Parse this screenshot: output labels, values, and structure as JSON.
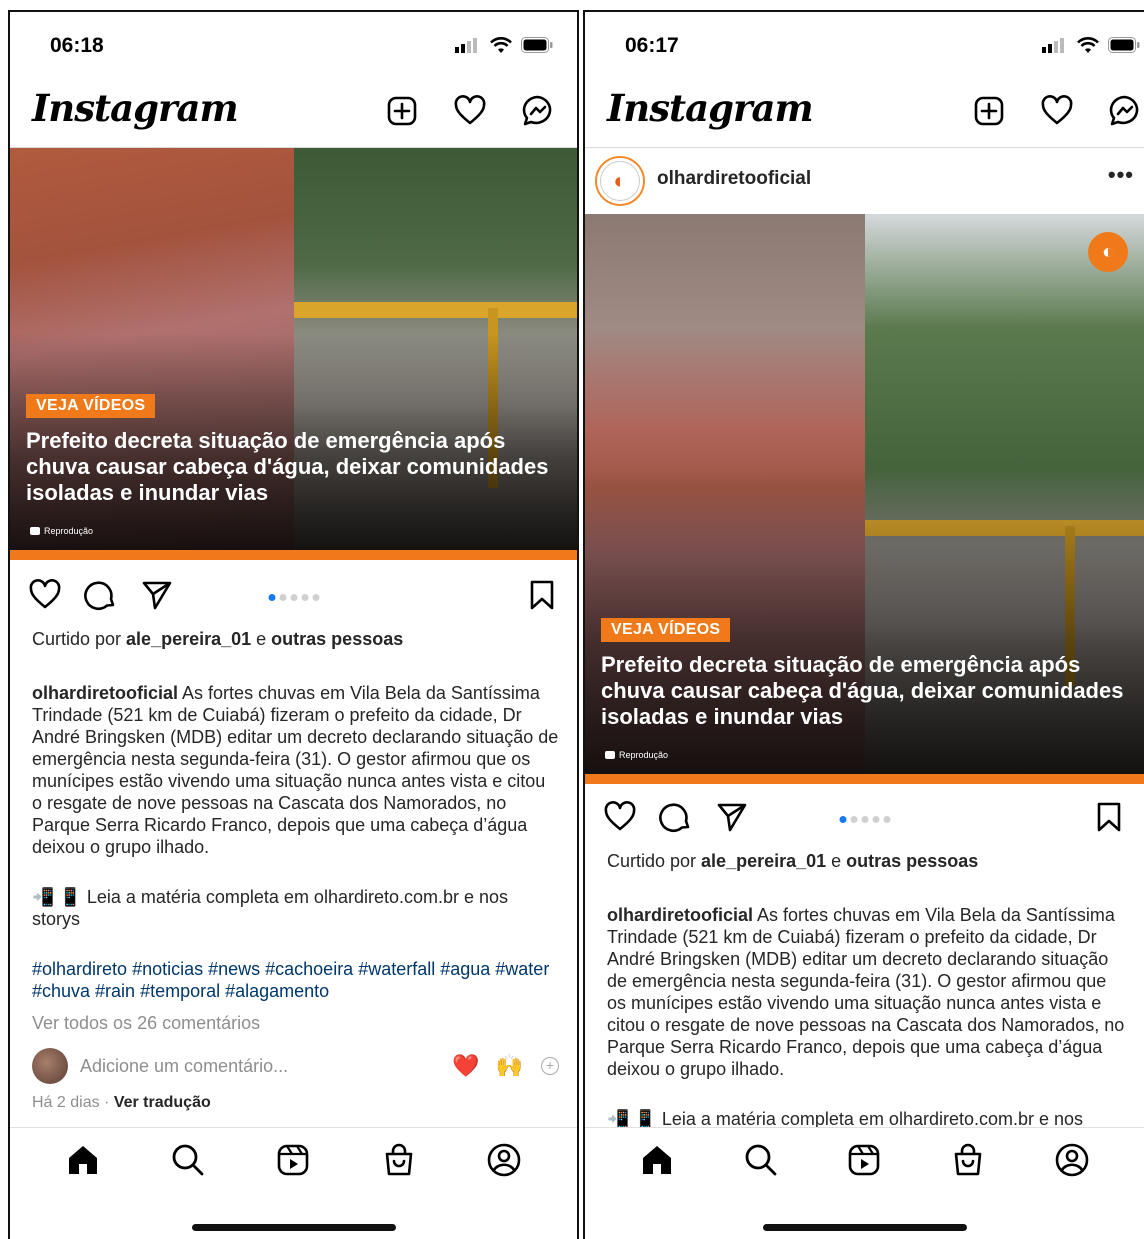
{
  "left": {
    "status": {
      "time": "06:18"
    },
    "app": {
      "logo": "Instagram"
    },
    "post": {
      "badge": "VEJA VÍDEOS",
      "headline": "Prefeito decreta situação de emergência após chuva causar cabeça d'água, deixar comunidades isoladas e inundar vias",
      "credit": "Reprodução",
      "likes_prefix": "Curtido por ",
      "likes_user": "ale_pereira_01",
      "likes_mid": " e ",
      "likes_rest": "outras pessoas",
      "caption_user": "olhardiretooficial",
      "caption_text": " As fortes chuvas em Vila Bela da Santíssima Trindade (521 km de Cuiabá) fizeram o prefeito da cidade, Dr André Bringsken (MDB) editar um decreto declarando situação de emergência nesta segunda-feira (31). O gestor afirmou que os munícipes estão vivendo uma situação nunca antes vista e citou o resgate de nove pessoas na Cascata dos Namorados, no Parque Serra Ricardo Franco, depois que uma cabeça d’água deixou o grupo ilhado.",
      "read_more": "📲 📱 Leia a matéria completa em olhardireto.com.br e nos storys",
      "hashtags": "#olhardireto #noticias #news #cachoeira #waterfall #agua #water #chuva #rain #temporal #alagamento",
      "view_comments": "Ver todos os 26 comentários",
      "comment_placeholder": "Adicione um comentário...",
      "emoji_1": "❤️",
      "emoji_2": "🙌",
      "time_ago": "Há 2 dias",
      "sep": " · ",
      "translate": "Ver tradução",
      "carousel_index": 1,
      "carousel_total": 5
    }
  },
  "right": {
    "status": {
      "time": "06:17"
    },
    "app": {
      "logo": "Instagram"
    },
    "post": {
      "owner": "olhardiretooficial",
      "more": "•••",
      "badge": "VEJA VÍDEOS",
      "headline": "Prefeito decreta situação de emergência após chuva causar cabeça d'água, deixar comunidades isoladas e inundar vias",
      "credit": "Reprodução",
      "likes_prefix": "Curtido por ",
      "likes_user": "ale_pereira_01",
      "likes_mid": " e ",
      "likes_rest": "outras pessoas",
      "caption_user": "olhardiretooficial",
      "caption_text": " As fortes chuvas em Vila Bela da Santíssima Trindade (521 km de Cuiabá) fizeram o prefeito da cidade, Dr André Bringsken (MDB) editar um decreto declarando situação de emergência nesta segunda-feira (31). O gestor afirmou que os munícipes estão vivendo uma situação nunca antes vista e citou o resgate de nove pessoas na Cascata dos Namorados, no Parque Serra Ricardo Franco, depois que uma cabeça d’água deixou o grupo ilhado.",
      "read_more": "📲 📱 Leia a matéria completa em olhardireto.com.br e nos",
      "carousel_index": 1,
      "carousel_total": 5
    }
  },
  "icons": {
    "header": [
      "new-post-icon",
      "heart-icon",
      "messenger-icon"
    ],
    "actions": [
      "like-icon",
      "comment-icon",
      "share-icon",
      "save-icon"
    ],
    "nav": [
      "home-icon",
      "search-icon",
      "reels-icon",
      "shop-icon",
      "profile-icon"
    ]
  },
  "colors": {
    "accent": "#f07a1a",
    "link": "#00376b",
    "muted": "#8e8e8e",
    "dot_active": "#1877f2"
  }
}
